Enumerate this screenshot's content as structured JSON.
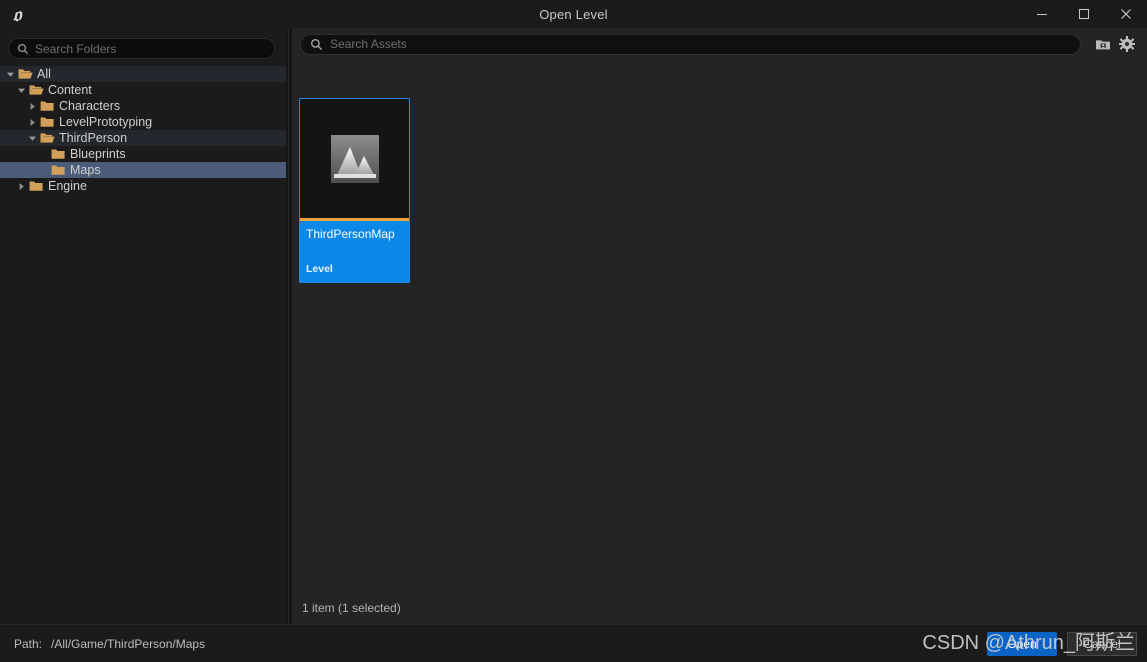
{
  "window": {
    "title": "Open Level",
    "logo_icon": "unreal-engine-logo",
    "controls": {
      "minimize": "minimize-icon",
      "maximize": "maximize-icon",
      "close": "close-icon"
    }
  },
  "folder_search": {
    "placeholder": "Search Folders",
    "icon": "search-icon",
    "value": ""
  },
  "tree": {
    "items": [
      {
        "label": "All",
        "depth": 0,
        "expander": "down",
        "folder": "folder-open-icon",
        "state": "tint"
      },
      {
        "label": "Content",
        "depth": 1,
        "expander": "down",
        "folder": "folder-open-icon",
        "state": "normal"
      },
      {
        "label": "Characters",
        "depth": 2,
        "expander": "right",
        "folder": "folder-closed-icon",
        "state": "normal"
      },
      {
        "label": "LevelPrototyping",
        "depth": 2,
        "expander": "right",
        "folder": "folder-closed-icon",
        "state": "normal"
      },
      {
        "label": "ThirdPerson",
        "depth": 2,
        "expander": "down",
        "folder": "folder-open-icon",
        "state": "tint"
      },
      {
        "label": "Blueprints",
        "depth": 3,
        "expander": "none",
        "folder": "folder-closed-icon",
        "state": "normal"
      },
      {
        "label": "Maps",
        "depth": 3,
        "expander": "none",
        "folder": "folder-closed-icon",
        "state": "select"
      },
      {
        "label": "Engine",
        "depth": 1,
        "expander": "right",
        "folder": "folder-closed-icon",
        "state": "normal"
      }
    ]
  },
  "asset_toolbar": {
    "search": {
      "placeholder": "Search Assets",
      "icon": "search-icon",
      "value": ""
    },
    "view_options_icon": "folder-settings-icon",
    "settings_icon": "gear-icon"
  },
  "assets": {
    "tiles": [
      {
        "name": "ThirdPersonMap",
        "type": "Level",
        "thumbnail_icon": "level-mountain-icon",
        "selected": true
      }
    ],
    "status": "1 item (1 selected)"
  },
  "footer": {
    "path_key": "Path:",
    "path_value": "/All/Game/ThirdPerson/Maps",
    "open_label": "Open",
    "cancel_label": "Cancel"
  },
  "watermark": {
    "text": "CSDN @Athrun_阿斯兰"
  },
  "colors": {
    "accent_blue": "#0b87e8",
    "selection_blue": "#4a5c78",
    "tile_border": "#2787e0",
    "tile_accent_orange": "#e8a33d",
    "folder_gold": "#d2a05a",
    "primary_button": "#0b63c6",
    "panel_dark": "#1b1b1b",
    "panel_mid": "#242424"
  }
}
